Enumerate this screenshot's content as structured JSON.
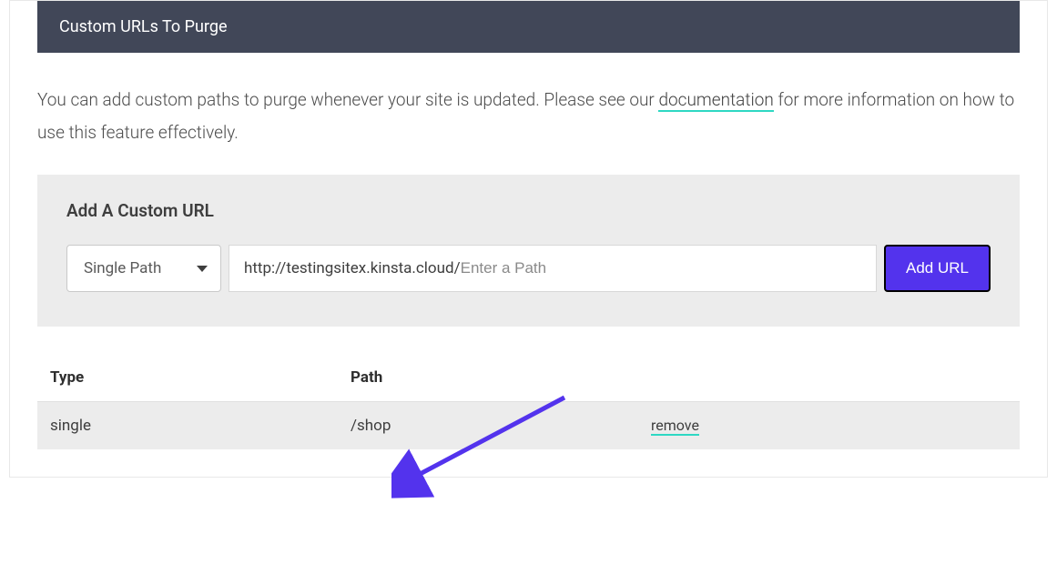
{
  "section": {
    "header": "Custom URLs To Purge",
    "description_prefix": "You can add custom paths to purge whenever your site is updated. Please see our ",
    "documentation_link": "documentation",
    "description_suffix": " for more information on how to use this feature effectively."
  },
  "form": {
    "title": "Add A Custom URL",
    "path_type_selected": "Single Path",
    "url_prefix": "http://testingsitex.kinsta.cloud/",
    "url_placeholder": "Enter a Path",
    "add_button": "Add URL"
  },
  "table": {
    "headers": {
      "type": "Type",
      "path": "Path"
    },
    "rows": [
      {
        "type": "single",
        "path": "/shop",
        "action": "remove"
      }
    ]
  }
}
